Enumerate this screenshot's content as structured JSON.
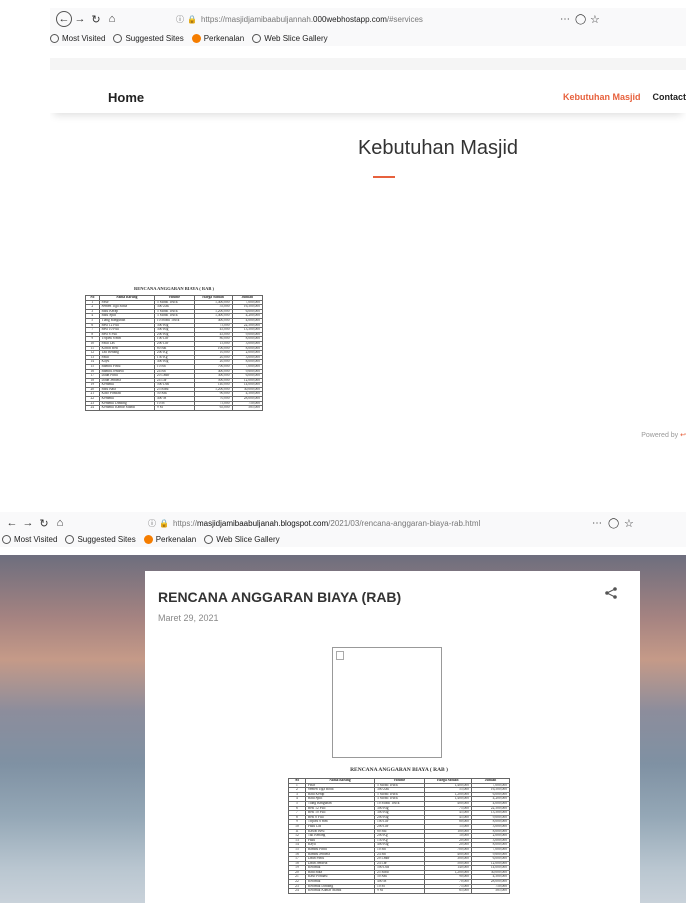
{
  "top": {
    "url_pre": "https://masjidjamibaabuljannah.",
    "url_host": "000webhostapp.com",
    "url_post": "/#services",
    "bookmarks": [
      "Most Visited",
      "Suggested Sites",
      "Perkenalan",
      "Web Slice Gallery"
    ],
    "home": "Home",
    "nav_active": "Kebutuhan Masjid",
    "nav_contact": "Contact",
    "section_title": "Kebutuhan Masjid",
    "powered_by": "Powered by"
  },
  "bottom": {
    "url_pre": "https://",
    "url_host": "masjidjamibaabuljanah.blogspot.com",
    "url_post": "/2021/03/rencana-anggaran-biaya-rab.html",
    "bookmarks": [
      "Most Visited",
      "Suggested Sites",
      "Perkenalan",
      "Web Slice Gallery"
    ],
    "post_title": "RENCANA ANGGARAN BIAYA (RAB)",
    "post_date": "Maret 29, 2021"
  },
  "rab": {
    "title": "RENCANA ANGGARAN BIAYA ( RAB )",
    "headers": [
      "No",
      "Nama Barang",
      "Volume",
      "Harga Satuan",
      "Jumlah"
    ],
    "rows": [
      [
        "1",
        "Pasir",
        "5 Mobil Truck",
        "1,400,000",
        "7,000,000"
      ],
      [
        "2",
        "Semen Tiga Roda",
        "300 Zak",
        "55,000",
        "16,500,000"
      ],
      [
        "3",
        "Batu Kerap",
        "5 Mobil Truck",
        "1,200,000",
        "6,000,000"
      ],
      [
        "4",
        "Batu Split",
        "3 Mobil Truck",
        "1,400,000",
        "4,200,000"
      ],
      [
        "5",
        "Tiang Bangunan",
        "10 Mobil Truck",
        "400,000",
        "4,000,000"
      ],
      [
        "6",
        "Besi 12 Full",
        "300 Btg",
        "75,000",
        "22,500,000"
      ],
      [
        "7",
        "Besi 10 Full",
        "300 Btg",
        "45,000",
        "13,500,000"
      ],
      [
        "8",
        "Besi 8 Full",
        "200 Btg",
        "45,000",
        "9,000,000"
      ],
      [
        "9",
        "Triplek 6 mm",
        "100 Lbr",
        "80,000",
        "8,000,000"
      ],
      [
        "10",
        "Paku Las",
        "200 Lbr",
        "15,000",
        "3,000,000"
      ],
      [
        "11",
        "Kawat Besi",
        "80 Bal",
        "100,000",
        "8,000,000"
      ],
      [
        "12",
        "Tali Benang",
        "200 Kg",
        "10,000",
        "2,000,000"
      ],
      [
        "13",
        "Paku",
        "150 Kg",
        "20,000",
        "3,000,000"
      ],
      [
        "14",
        "Kayu",
        "400 Btg",
        "20,000",
        "8,000,000"
      ],
      [
        "15",
        "Bambu Pintu",
        "10 Bh",
        "700,000",
        "7,000,000"
      ],
      [
        "16",
        "Bambu Jendela",
        "24 Bh",
        "400,000",
        "9,600,000"
      ],
      [
        "17",
        "Daun Pintu",
        "20 Lmbr",
        "300,000",
        "6,000,000"
      ],
      [
        "18",
        "Daun Jendela",
        "24 Lbr",
        "500,000",
        "12,000,000"
      ],
      [
        "19",
        "Keramik",
        "500 Dus",
        "140,000",
        "14,000,000"
      ],
      [
        "20",
        "Batu Bata",
        "25 Ribu",
        "1,200,000",
        "30,000,000"
      ],
      [
        "21",
        "Kaso Pondasi",
        "50 Sak",
        "90,000",
        "4,500,000"
      ],
      [
        "22",
        "Keramik",
        "400 M",
        "70,000",
        "28,000,000"
      ],
      [
        "23",
        "Keramik Dinding",
        "10 M",
        "75,000",
        "750,000"
      ],
      [
        "24",
        "Keramik Kamar Mandi",
        "9 M",
        "65,000",
        "585,000"
      ]
    ]
  },
  "colors": {
    "accent": "#e7613d",
    "secure_lock": "#2c9f2c"
  }
}
